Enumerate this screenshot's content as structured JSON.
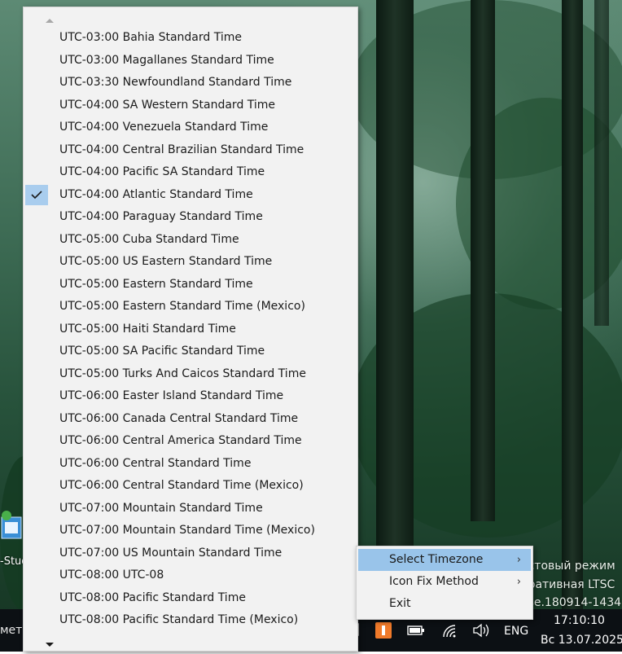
{
  "menu": {
    "items": [
      {
        "label": "UTC-03:00 Bahia Standard Time",
        "checked": false
      },
      {
        "label": "UTC-03:00 Magallanes Standard Time",
        "checked": false
      },
      {
        "label": "UTC-03:30 Newfoundland Standard Time",
        "checked": false
      },
      {
        "label": "UTC-04:00 SA Western Standard Time",
        "checked": false
      },
      {
        "label": "UTC-04:00 Venezuela Standard Time",
        "checked": false
      },
      {
        "label": "UTC-04:00 Central Brazilian Standard Time",
        "checked": false
      },
      {
        "label": "UTC-04:00 Pacific SA Standard Time",
        "checked": false
      },
      {
        "label": "UTC-04:00 Atlantic Standard Time",
        "checked": true
      },
      {
        "label": "UTC-04:00 Paraguay Standard Time",
        "checked": false
      },
      {
        "label": "UTC-05:00 Cuba Standard Time",
        "checked": false
      },
      {
        "label": "UTC-05:00 US Eastern Standard Time",
        "checked": false
      },
      {
        "label": "UTC-05:00 Eastern Standard Time",
        "checked": false
      },
      {
        "label": "UTC-05:00 Eastern Standard Time (Mexico)",
        "checked": false
      },
      {
        "label": "UTC-05:00 Haiti Standard Time",
        "checked": false
      },
      {
        "label": "UTC-05:00 SA Pacific Standard Time",
        "checked": false
      },
      {
        "label": "UTC-05:00 Turks And Caicos Standard Time",
        "checked": false
      },
      {
        "label": "UTC-06:00 Easter Island Standard Time",
        "checked": false
      },
      {
        "label": "UTC-06:00 Canada Central Standard Time",
        "checked": false
      },
      {
        "label": "UTC-06:00 Central America Standard Time",
        "checked": false
      },
      {
        "label": "UTC-06:00 Central Standard Time",
        "checked": false
      },
      {
        "label": "UTC-06:00 Central Standard Time (Mexico)",
        "checked": false
      },
      {
        "label": "UTC-07:00 Mountain Standard Time",
        "checked": false
      },
      {
        "label": "UTC-07:00 Mountain Standard Time (Mexico)",
        "checked": false
      },
      {
        "label": "UTC-07:00 US Mountain Standard Time",
        "checked": false
      },
      {
        "label": "UTC-08:00 UTC-08",
        "checked": false
      },
      {
        "label": "UTC-08:00 Pacific Standard Time",
        "checked": false
      },
      {
        "label": "UTC-08:00 Pacific Standard Time (Mexico)",
        "checked": false
      }
    ]
  },
  "context_menu": {
    "select_timezone": "Select Timezone",
    "icon_fix_method": "Icon Fix Method",
    "exit": "Exit",
    "highlighted_color": "#99c4ea"
  },
  "watermark": {
    "line1": "естовый режим",
    "line2": "оративная LTSC",
    "line3": "ase.180914-1434"
  },
  "desktop_icon": {
    "label": "-Stud"
  },
  "taskbar": {
    "left_text": "метр",
    "language": "ENG",
    "time": "17:10:10",
    "date": "Вс 13.07.2025",
    "icons": [
      "tray-app-icon",
      "orange-app-icon",
      "battery-icon",
      "wifi-icon",
      "volume-icon"
    ]
  },
  "colors": {
    "menu_bg": "#f2f2f2",
    "check_bg": "#a9cdee",
    "taskbar_bg": "#0c1014"
  }
}
